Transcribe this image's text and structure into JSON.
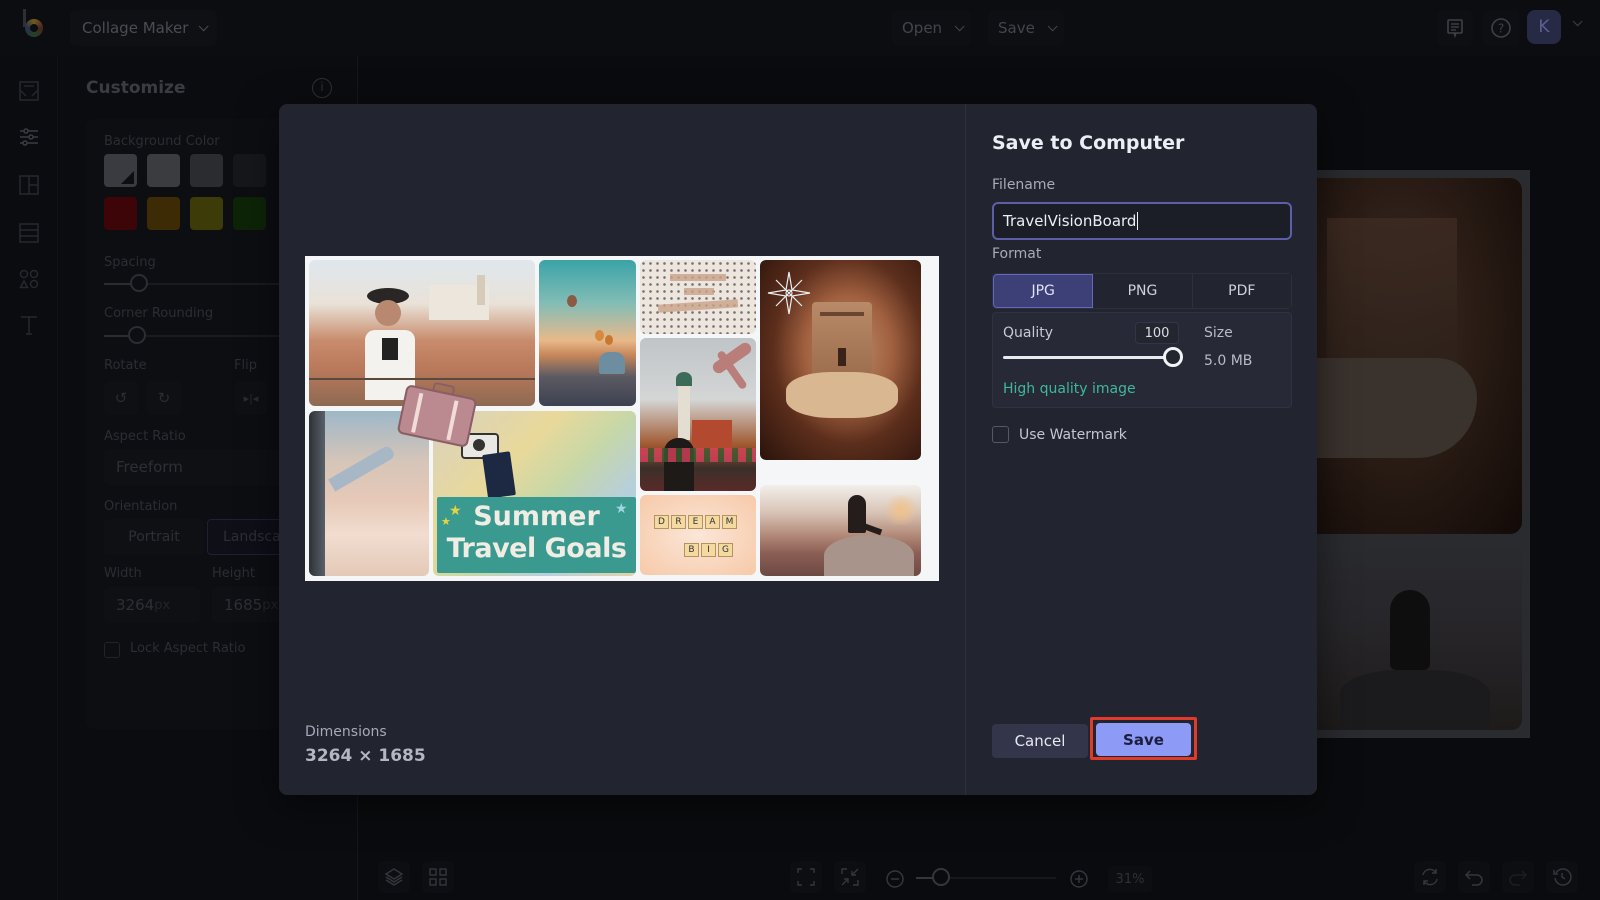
{
  "app": {
    "name": "Collage Maker",
    "top_menu": [
      {
        "label": "Open"
      },
      {
        "label": "Save"
      }
    ],
    "user_initial": "K"
  },
  "side_panel": {
    "title": "Customize",
    "background_color_label": "Background Color",
    "swatches": [
      "#3a3b40",
      "#3b3c40",
      "#2b2c30",
      "#16171a",
      "#3e0509",
      "#3d2b05",
      "#3d3b08",
      "#0d2407"
    ],
    "spacing_label": "Spacing",
    "corner_rounding_label": "Corner Rounding",
    "rotate_label": "Rotate",
    "flip_label": "Flip",
    "aspect_ratio_label": "Aspect Ratio",
    "aspect_ratio_value": "Freeform",
    "orientation_label": "Orientation",
    "orientation_options": [
      "Portrait",
      "Landscape"
    ],
    "orientation_selected": "Landscape",
    "width_label": "Width",
    "height_label": "Height",
    "width_value": "3264",
    "height_value": "1685",
    "unit": "px",
    "lock_aspect_label": "Lock Aspect Ratio"
  },
  "bottom_bar": {
    "zoom_percent": "31%",
    "zoom_level": 0.31
  },
  "modal": {
    "title": "Save to Computer",
    "filename_label": "Filename",
    "filename_value": "TravelVisionBoard",
    "format_label": "Format",
    "formats": [
      "JPG",
      "PNG",
      "PDF"
    ],
    "format_selected": "JPG",
    "quality_label": "Quality",
    "quality_value": "100",
    "size_label": "Size",
    "size_value": "5.0 MB",
    "quality_hint": "High quality image",
    "watermark_label": "Use Watermark",
    "watermark_checked": false,
    "dimensions_label": "Dimensions",
    "dimensions_value": "3264 × 1685",
    "cancel_label": "Cancel",
    "save_label": "Save",
    "preview": {
      "banner_line1": "Summer",
      "banner_line2": "Travel Goals",
      "scrabble_line1": "DREAM",
      "scrabble_line2": "BIG"
    }
  },
  "colors": {
    "accent": "#8d9bf7",
    "selected_format_bg": "#3d4076",
    "hint_green": "#3fb79d",
    "highlight_red": "#e23a2a"
  }
}
